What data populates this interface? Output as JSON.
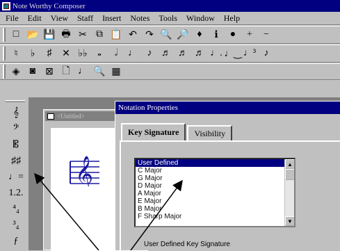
{
  "window": {
    "title": "Note Worthy Composer"
  },
  "menu": [
    "File",
    "Edit",
    "View",
    "Staff",
    "Insert",
    "Notes",
    "Tools",
    "Window",
    "Help"
  ],
  "toolbar1": [
    {
      "icon": "new-icon",
      "glyph": "□"
    },
    {
      "icon": "open-icon",
      "glyph": "📂"
    },
    {
      "icon": "save-icon",
      "glyph": "💾"
    },
    {
      "icon": "print-icon",
      "glyph": "🖶"
    },
    {
      "icon": "cut-icon",
      "glyph": "✂"
    },
    {
      "icon": "copy-icon",
      "glyph": "⧉"
    },
    {
      "icon": "paste-icon",
      "glyph": "📋"
    },
    {
      "icon": "undo-icon",
      "glyph": "↶"
    },
    {
      "icon": "redo-icon",
      "glyph": "↷"
    },
    {
      "icon": "zoom-in-icon",
      "glyph": "🔍"
    },
    {
      "icon": "zoom-out-icon",
      "glyph": "🔎"
    },
    {
      "icon": "instrument-icon",
      "glyph": "♦"
    },
    {
      "icon": "info-icon",
      "glyph": "ℹ"
    },
    {
      "icon": "play-icon",
      "glyph": "●"
    },
    {
      "icon": "add-icon",
      "glyph": "+"
    },
    {
      "icon": "minus-icon",
      "glyph": "−"
    }
  ],
  "toolbar2": [
    {
      "icon": "natural-icon",
      "glyph": "♮"
    },
    {
      "icon": "flat-icon",
      "glyph": "♭"
    },
    {
      "icon": "sharp-icon",
      "glyph": "♯"
    },
    {
      "icon": "double-sharp-icon",
      "glyph": "✕"
    },
    {
      "icon": "double-flat-icon",
      "glyph": "♭♭"
    },
    {
      "icon": "whole-note-icon",
      "glyph": "𝅝"
    },
    {
      "icon": "half-note-icon",
      "glyph": "𝅗𝅥"
    },
    {
      "icon": "quarter-note-icon",
      "glyph": "♩"
    },
    {
      "icon": "eighth-note-icon",
      "glyph": "♪"
    },
    {
      "icon": "sixteenth-note-icon",
      "glyph": "♬"
    },
    {
      "icon": "thirty-second-note-icon",
      "glyph": "♬"
    },
    {
      "icon": "sixty-fourth-note-icon",
      "glyph": "♬"
    },
    {
      "icon": "dotted-note-icon",
      "glyph": "♩."
    },
    {
      "icon": "tied-note-icon",
      "glyph": "♩‿"
    },
    {
      "icon": "triplet-icon",
      "glyph": "♩³"
    },
    {
      "icon": "grace-note-icon",
      "glyph": "♪"
    }
  ],
  "toolbar3": [
    {
      "icon": "staff-icon",
      "glyph": "◈"
    },
    {
      "icon": "tempo-icon",
      "glyph": "◙"
    },
    {
      "icon": "instrument-patch-icon",
      "glyph": "⊠"
    },
    {
      "icon": "page-setup-icon",
      "glyph": "🗋"
    },
    {
      "icon": "dynamic-icon",
      "glyph": "♩"
    },
    {
      "icon": "find-icon",
      "glyph": "🔍"
    },
    {
      "icon": "grid-icon",
      "glyph": "▦"
    }
  ],
  "sidebar": [
    {
      "icon": "treble-clef-icon",
      "glyph": "𝄞"
    },
    {
      "icon": "bass-clef-icon",
      "glyph": "𝄢"
    },
    {
      "icon": "alto-clef-icon",
      "glyph": "𝄡"
    },
    {
      "icon": "key-signature-icon",
      "glyph": "♯♯"
    },
    {
      "icon": "tempo-mark-icon",
      "glyph": "♩="
    },
    {
      "icon": "ending-icon",
      "glyph": "1.2."
    },
    {
      "icon": "time-signature-icon",
      "glyph": "⁴₄"
    },
    {
      "icon": "time-signature-alt-icon",
      "glyph": "³₄"
    },
    {
      "icon": "dynamics-icon",
      "glyph": "ƒ"
    }
  ],
  "document": {
    "title": "<Untitled>"
  },
  "dialog": {
    "title": "Notation Properties",
    "tabs": [
      "Key Signature",
      "Visibility"
    ],
    "key_list": [
      "User Defined",
      "C Major",
      "G Major",
      "D Major",
      "A Major",
      "E Major",
      "B Major",
      "F Sharp Major"
    ],
    "selected_index": 0,
    "caption": "User Defined Key Signature"
  }
}
